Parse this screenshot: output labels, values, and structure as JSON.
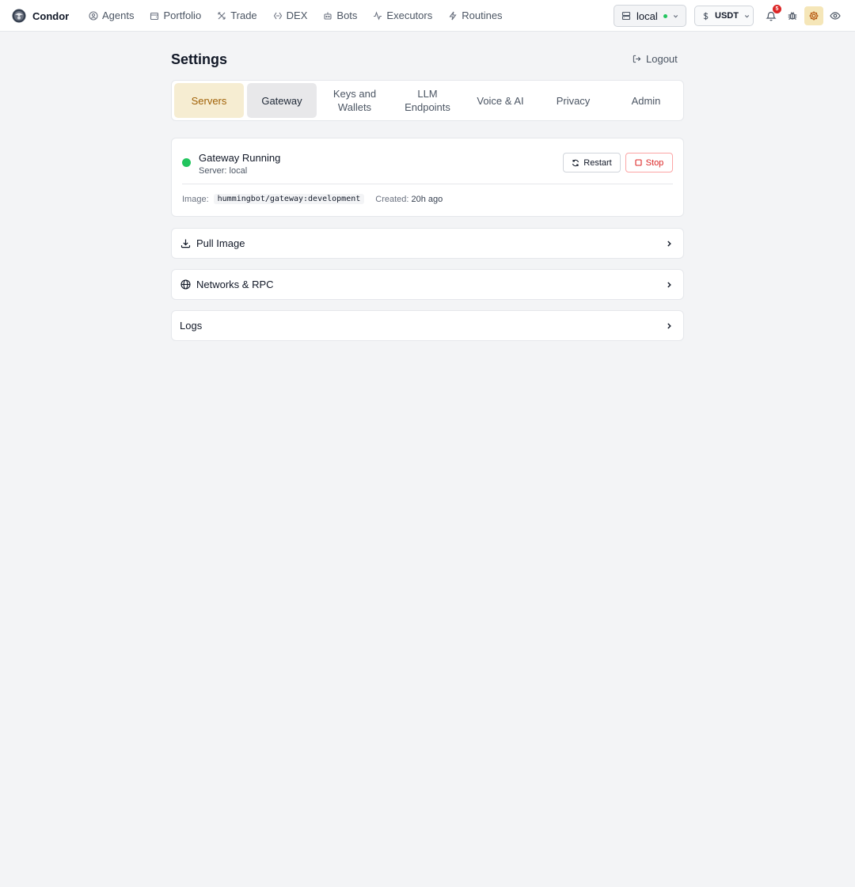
{
  "app": {
    "name": "Condor"
  },
  "nav": {
    "items": [
      {
        "label": "Agents",
        "icon": "agents-icon"
      },
      {
        "label": "Portfolio",
        "icon": "portfolio-icon"
      },
      {
        "label": "Trade",
        "icon": "trade-icon"
      },
      {
        "label": "DEX",
        "icon": "dex-icon"
      },
      {
        "label": "Bots",
        "icon": "bots-icon"
      },
      {
        "label": "Executors",
        "icon": "executors-icon"
      },
      {
        "label": "Routines",
        "icon": "routines-icon"
      }
    ]
  },
  "server_select": {
    "value": "local",
    "status_color": "#22c55e"
  },
  "currency_select": {
    "value": "USDT"
  },
  "notifications": {
    "count": "5"
  },
  "page": {
    "title": "Settings",
    "logout_label": "Logout"
  },
  "tabs": [
    {
      "label": "Servers"
    },
    {
      "label": "Keys and Wallets"
    },
    {
      "label": "Gateway"
    },
    {
      "label": "LLM Endpoints"
    },
    {
      "label": "Voice & AI"
    },
    {
      "label": "Privacy"
    },
    {
      "label": "Admin"
    }
  ],
  "tab_labels": {
    "servers": "Servers",
    "gateway": "Gateway",
    "keys": "Keys and Wallets",
    "llm": "LLM Endpoints",
    "voice": "Voice & AI",
    "privacy": "Privacy",
    "admin": "Admin"
  },
  "gateway": {
    "status_title": "Gateway Running",
    "status_color": "#22c55e",
    "server_line": "Server: local",
    "restart_label": "Restart",
    "stop_label": "Stop",
    "image_key": "Image:",
    "image_value": "hummingbot/gateway:development",
    "created_key": "Created:",
    "created_value": "20h ago"
  },
  "sections": {
    "pull_image": "Pull Image",
    "networks": "Networks & RPC",
    "logs": "Logs"
  }
}
